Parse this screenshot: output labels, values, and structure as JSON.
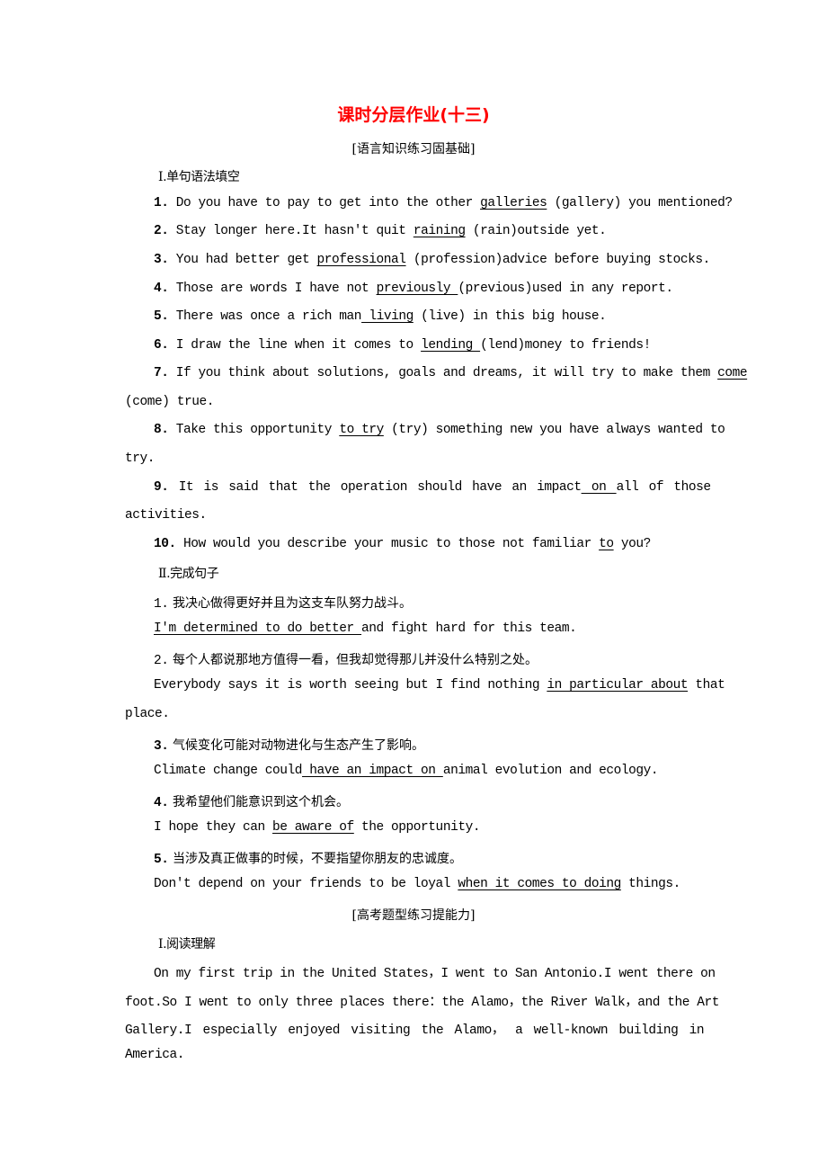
{
  "title": "课时分层作业(十三)",
  "part1_heading": "[语言知识练习固基础]",
  "section1": {
    "heading": "Ⅰ.单句语法填空",
    "items": [
      {
        "num": "1.",
        "pre": " Do you have to pay to get into the other ",
        "answer": "galleries",
        "post": " (gallery) you mentioned?"
      },
      {
        "num": "2.",
        "pre": " Stay longer here.It hasn't quit ",
        "answer": "raining",
        "post": " (rain)outside yet."
      },
      {
        "num": "3.",
        "pre": " You had better get ",
        "answer": "professional",
        "post": " (profession)advice before buying stocks."
      },
      {
        "num": "4.",
        "pre": " Those are words I have not ",
        "answer": "previously ",
        "post": "(previous)used in any report."
      },
      {
        "num": "5.",
        "pre": " There was once a rich man",
        "answer": " living",
        "post": " (live) in this big house."
      },
      {
        "num": "6.",
        "pre": " I draw the line when it comes to ",
        "answer": "lending ",
        "post": "(lend)money to friends!"
      },
      {
        "num": "7.",
        "pre": " If you think about solutions, goals and dreams, it will try to make them ",
        "answer": "come",
        "post": "",
        "cont": "(come) true."
      },
      {
        "num": "8.",
        "pre": " Take this opportunity ",
        "answer": "to try",
        "post": " (try) something new you have always wanted to",
        "cont": "try."
      },
      {
        "num": "9.",
        "pre": " It is said that the operation should have an impact",
        "answer": " on ",
        "post": "all of those",
        "cont": "activities."
      },
      {
        "num": "10.",
        "pre": " How would you describe your music to those not familiar ",
        "answer": "to",
        "post": " you?"
      }
    ]
  },
  "section2": {
    "heading": "Ⅱ.完成句子",
    "items": [
      {
        "num": "1.",
        "cn": " 我决心做得更好并且为这支车队努力战斗。",
        "answer": "I'm determined to do better ",
        "post": "and fight hard for this team.",
        "pre": ""
      },
      {
        "num": "2.",
        "cn": " 每个人都说那地方值得一看，但我却觉得那儿并没什么特别之处。",
        "pre": "Everybody says it is worth seeing but I find nothing ",
        "answer": "in particular about",
        "post": " that",
        "cont": "place."
      },
      {
        "num": "3.",
        "cn": " 气候变化可能对动物进化与生态产生了影响。",
        "pre": "Climate change could",
        "answer": " have an impact on ",
        "post": "animal evolution and ecology."
      },
      {
        "num": "4.",
        "cn": " 我希望他们能意识到这个机会。",
        "pre": "I hope they can ",
        "answer": "be aware of",
        "post": " the opportunity."
      },
      {
        "num": "5.",
        "cn": " 当涉及真正做事的时候，不要指望你朋友的忠诚度。",
        "pre": "Don't depend on your friends to be loyal ",
        "answer": "when it comes to doing",
        "post": " things."
      }
    ]
  },
  "part2_heading": "[高考题型练习提能力]",
  "section3": {
    "heading": "Ⅰ.阅读理解",
    "lines": [
      "On my first trip in the United States，I went to San Antonio.I went there on",
      "foot.So I went to only three places there：the Alamo，the River Walk，and the Art",
      "Gallery.I especially enjoyed visiting the Alamo， a well-known building in",
      "America."
    ]
  }
}
